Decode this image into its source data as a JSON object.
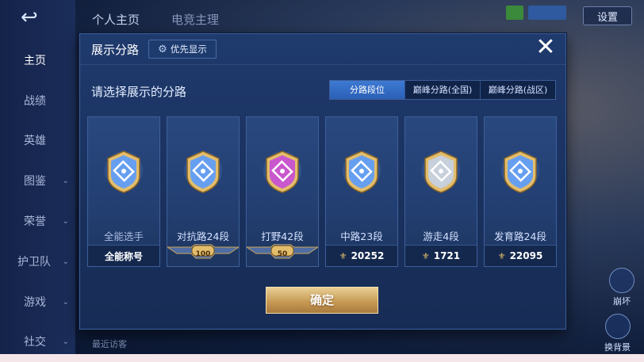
{
  "background": {
    "back_label": "↩",
    "top_tabs": [
      "个人主页",
      "电竞主理"
    ],
    "settings_label": "设置",
    "left_nav": [
      {
        "label": "主页",
        "active": true,
        "chevron": false
      },
      {
        "label": "战绩",
        "active": false,
        "chevron": false
      },
      {
        "label": "英雄",
        "active": false,
        "chevron": false
      },
      {
        "label": "图鉴",
        "active": false,
        "chevron": true
      },
      {
        "label": "荣誉",
        "active": false,
        "chevron": true
      },
      {
        "label": "护卫队",
        "active": false,
        "chevron": true
      },
      {
        "label": "游戏",
        "active": false,
        "chevron": true
      },
      {
        "label": "社交",
        "active": false,
        "chevron": true
      }
    ],
    "recent_visitors": "最近访客",
    "right_buttons": [
      "崩坏",
      "换背景"
    ]
  },
  "dialog": {
    "title": "展示分路",
    "priority_label": "优先显示",
    "close_symbol": "✕",
    "subtitle": "请选择展示的分路",
    "filter_tabs": [
      {
        "label": "分路段位",
        "active": true
      },
      {
        "label": "巅峰分路(全国)",
        "active": false
      },
      {
        "label": "巅峰分路(战区)",
        "active": false
      }
    ],
    "cards": [
      {
        "title": "全能选手",
        "bottom": "全能称号",
        "badge": "all-round",
        "kind": "text",
        "color": "#5a9bff"
      },
      {
        "title": "对抗路24段",
        "bottom": "100",
        "badge": "clash-lane",
        "kind": "ribbon",
        "color": "#5a9bff"
      },
      {
        "title": "打野42段",
        "bottom": "50",
        "badge": "jungle",
        "kind": "ribbon",
        "color": "#c64bd8"
      },
      {
        "title": "中路23段",
        "bottom": "20252",
        "badge": "mid-lane",
        "kind": "power",
        "color": "#5a9bff"
      },
      {
        "title": "游走4段",
        "bottom": "1721",
        "badge": "roam",
        "kind": "power",
        "color": "#c4d2e8"
      },
      {
        "title": "发育路24段",
        "bottom": "22095",
        "badge": "farm-lane",
        "kind": "power",
        "color": "#5a9bff"
      }
    ],
    "confirm_label": "确定"
  },
  "colors": {
    "gold": "#e2bd6c",
    "accent_blue": "#3e7ad3",
    "panel": "#1f3a6d"
  }
}
